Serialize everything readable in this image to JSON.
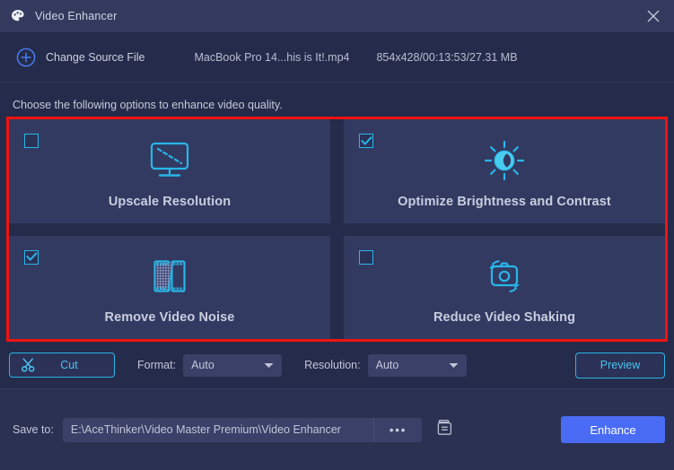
{
  "window": {
    "title": "Video Enhancer",
    "app_icon": "palette-icon",
    "close_icon": "close-icon"
  },
  "source_bar": {
    "add_icon": "plus-circle-icon",
    "change_source_label": "Change Source File",
    "file_name": "MacBook Pro 14...his is It!.mp4",
    "file_meta": "854x428/00:13:53/27.31 MB"
  },
  "main": {
    "instruction": "Choose the following options to enhance video quality.",
    "highlight_color": "#f0140f",
    "accent_color": "#29b6e8",
    "options": [
      {
        "label": "Upscale Resolution",
        "checked": false,
        "icon": "monitor-upscale-icon"
      },
      {
        "label": "Optimize Brightness and Contrast",
        "checked": true,
        "icon": "sun-brightness-icon"
      },
      {
        "label": "Remove Video Noise",
        "checked": true,
        "icon": "film-noise-icon"
      },
      {
        "label": "Reduce Video Shaking",
        "checked": false,
        "icon": "camera-stabilize-icon"
      }
    ]
  },
  "toolbar": {
    "cut_label": "Cut",
    "cut_icon": "scissors-icon",
    "format_label": "Format:",
    "format_value": "Auto",
    "resolution_label": "Resolution:",
    "resolution_value": "Auto",
    "preview_label": "Preview",
    "dropdown_icon": "chevron-down-icon"
  },
  "save_bar": {
    "save_to_label": "Save to:",
    "path_value": "E:\\AceThinker\\Video Master Premium\\Video Enhancer",
    "browse_label": "•••",
    "folder_icon": "folder-open-icon",
    "enhance_label": "Enhance",
    "enhance_color": "#4a6cf5"
  }
}
